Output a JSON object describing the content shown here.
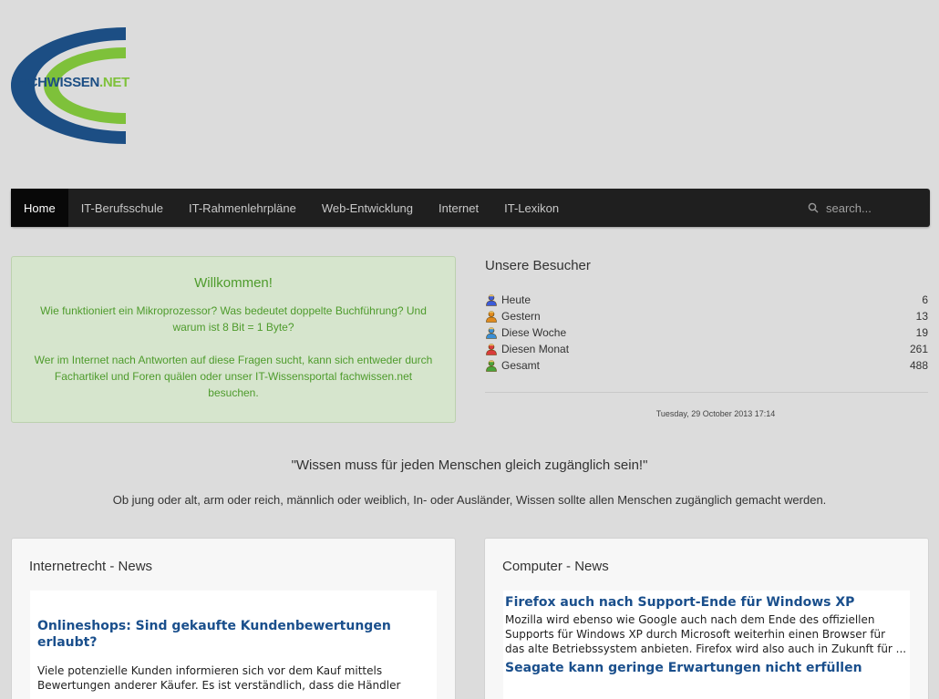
{
  "logo": {
    "text_a": "FACHWISSEN",
    "text_b": ".NET"
  },
  "nav": {
    "items": [
      "Home",
      "IT-Berufsschule",
      "IT-Rahmenlehrpläne",
      "Web-Entwicklung",
      "Internet",
      "IT-Lexikon"
    ],
    "active": 0,
    "search_placeholder": "search..."
  },
  "welcome": {
    "title": "Willkommen!",
    "p1": "Wie funktioniert ein Mikroprozessor? Was bedeutet doppelte Buchführung? Und warum ist 8 Bit = 1 Byte?",
    "p2": "Wer im Internet nach Antworten auf diese Fragen sucht, kann sich entweder durch Fachartikel und Foren quälen oder unser IT-Wissensportal fachwissen.net besuchen."
  },
  "visitors": {
    "title": "Unsere Besucher",
    "rows": [
      {
        "label": "Heute",
        "value": "6",
        "color": "#3b5bd9"
      },
      {
        "label": "Gestern",
        "value": "13",
        "color": "#e08a1e"
      },
      {
        "label": "Diese Woche",
        "value": "19",
        "color": "#3a8fd6"
      },
      {
        "label": "Diesen Monat",
        "value": "261",
        "color": "#d93b3b"
      },
      {
        "label": "Gesamt",
        "value": "488",
        "color": "#4aa33a"
      }
    ],
    "date": "Tuesday, 29 October 2013 17:14"
  },
  "quote": {
    "main": "\"Wissen muss für jeden Menschen gleich zugänglich sein!\"",
    "sub": "Ob jung oder alt, arm oder reich, männlich oder weiblich, In- oder Ausländer, Wissen sollte allen Menschen zugänglich gemacht werden."
  },
  "news_left": {
    "title": "Internetrecht - News",
    "item_title": "Onlineshops: Sind gekaufte Kundenbewertungen erlaubt?",
    "item_text": "Viele potenzielle Kunden informieren sich vor dem Kauf mittels Bewertungen anderer Käufer. Es ist verständlich, dass die Händler"
  },
  "news_right": {
    "title": "Computer - News",
    "items": [
      {
        "title": "Firefox auch nach Support-Ende für Windows XP",
        "text": "Mozilla wird ebenso wie Google auch nach dem Ende des offiziellen Supports für Windows XP durch Microsoft weiterhin einen Browser für das alte Betriebssystem anbieten. Firefox wird also auch in Zukunft für ..."
      },
      {
        "title": "Seagate kann geringe Erwartungen nicht erfüllen",
        "text": ""
      }
    ]
  },
  "colors": {
    "brand_blue": "#1c4e84",
    "brand_green": "#7ec13a",
    "nav_bg": "#1f1f1f",
    "welcome_bg": "#d6e5cd"
  }
}
